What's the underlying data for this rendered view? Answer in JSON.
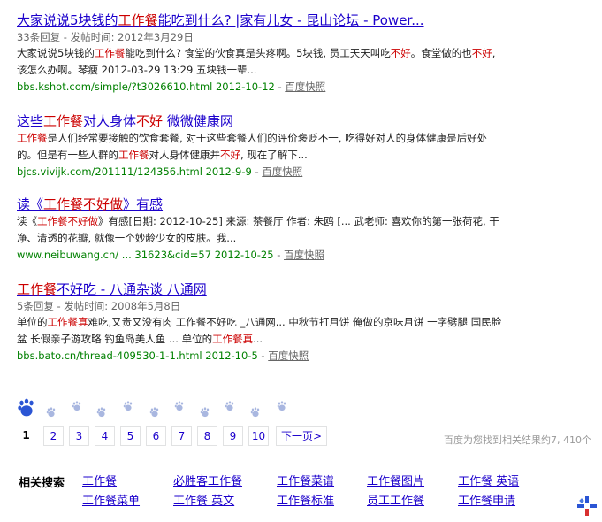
{
  "results": [
    {
      "title_parts": [
        {
          "t": "大家说说5块钱的",
          "hl": false
        },
        {
          "t": "工作餐",
          "hl": true
        },
        {
          "t": "能吃到什么? |家有儿女 - 昆山论坛 - Power...",
          "hl": false
        }
      ],
      "meta": "33条回复 - 发帖时间: 2012年3月29日",
      "abstract_parts": [
        {
          "t": "大家说说5块钱的",
          "hl": false
        },
        {
          "t": "工作餐",
          "hl": true
        },
        {
          "t": "能吃到什么? 食堂的伙食真是头疼啊。5块钱, 员工天天叫吃",
          "hl": false
        },
        {
          "t": "不好",
          "hl": true
        },
        {
          "t": "。食堂做的也",
          "hl": false
        },
        {
          "t": "不好",
          "hl": true
        },
        {
          "t": ", 该怎么办啊。琴瘦 2012-03-29 13:29 五块钱一辈...",
          "hl": false
        }
      ],
      "url": "bbs.kshot.com/simple/?t3026610.html 2012-10-12",
      "cache": "百度快照"
    },
    {
      "title_parts": [
        {
          "t": "这些",
          "hl": false
        },
        {
          "t": "工作餐",
          "hl": true
        },
        {
          "t": "对人身体",
          "hl": false
        },
        {
          "t": "不好",
          "hl": true
        },
        {
          "t": " 微微健康网",
          "hl": false
        }
      ],
      "meta": "",
      "abstract_parts": [
        {
          "t": "工作餐",
          "hl": true
        },
        {
          "t": "是人们经常要接触的饮食套餐, 对于这些套餐人们的评价褒贬不一, 吃得好对人的身体健康是后好处的。但是有一些人群的",
          "hl": false
        },
        {
          "t": "工作餐",
          "hl": true
        },
        {
          "t": "对人身体健康并",
          "hl": false
        },
        {
          "t": "不好",
          "hl": true
        },
        {
          "t": ", 现在了解下...",
          "hl": false
        }
      ],
      "url": "bjcs.vivijk.com/201111/124356.html 2012-9-9",
      "cache": "百度快照"
    },
    {
      "title_parts": [
        {
          "t": "读《",
          "hl": false
        },
        {
          "t": "工作餐不好做",
          "hl": true
        },
        {
          "t": "》有感",
          "hl": false
        }
      ],
      "meta": "",
      "abstract_parts": [
        {
          "t": "读《",
          "hl": false
        },
        {
          "t": "工作餐不好做",
          "hl": true
        },
        {
          "t": "》有感[日期: 2012-10-25] 来源: 茶餐厅 作者: 朱鸥 [... 武老师: 喜欢你的第一张荷花, 干净、清透的花瓣, 就像一个妙龄少女的皮肤。我...",
          "hl": false
        }
      ],
      "url": "www.neibuwang.cn/ ... 31623&cid=57 2012-10-25",
      "cache": "百度快照"
    },
    {
      "title_parts": [
        {
          "t": "工作餐",
          "hl": true
        },
        {
          "t": "不好吃 - 八通杂谈 八通网",
          "hl": false
        }
      ],
      "meta": "5条回复 - 发帖时间: 2008年5月8日",
      "abstract_parts": [
        {
          "t": "单位的",
          "hl": false
        },
        {
          "t": "工作餐真",
          "hl": true
        },
        {
          "t": "难吃,又贵又没有肉 工作餐不好吃 _八通网... 中秋节打月饼 俺做的京味月饼 一字劈腿 国民脸盆 长假亲子游攻略 钓鱼岛美人鱼 ... 单位的",
          "hl": false
        },
        {
          "t": "工作餐真",
          "hl": true
        },
        {
          "t": "...",
          "hl": false
        }
      ],
      "url": "bbs.bato.cn/thread-409530-1-1.html 2012-10-5",
      "cache": "百度快照"
    }
  ],
  "pager": {
    "pages": [
      "1",
      "2",
      "3",
      "4",
      "5",
      "6",
      "7",
      "8",
      "9",
      "10"
    ],
    "current": "1",
    "next": "下一页>"
  },
  "result_count": "百度为您找到相关结果约7, 410个",
  "related": {
    "label": "相关搜索",
    "row1": [
      "工作餐",
      "必胜客工作餐",
      "工作餐菜谱",
      "工作餐图片",
      "工作餐 英语"
    ],
    "row2": [
      "工作餐菜单",
      "工作餐 英文",
      "工作餐标准",
      "员工工作餐",
      "工作餐申请"
    ]
  },
  "colors": {
    "link": "#1b00cc",
    "highlight": "#cc0000",
    "url": "#008000",
    "meta": "#666666",
    "paw_active": "#2b55d4",
    "paw_inactive": "#a9b7e0"
  },
  "icons": [
    "baidu-paw-icon",
    "baidu-corner-logo-icon"
  ]
}
